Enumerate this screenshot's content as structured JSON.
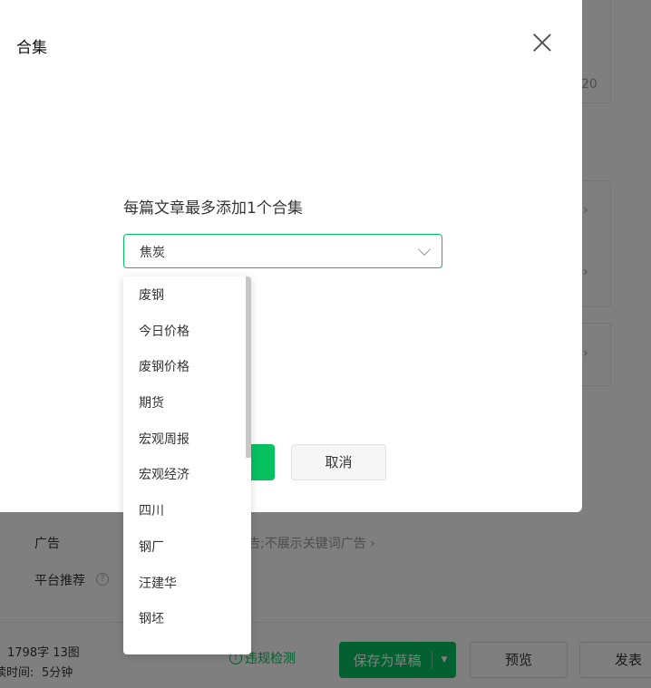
{
  "background": {
    "partial_count": "20",
    "ad_label": "广告",
    "ad_value": "告;不展示关键词广告",
    "ad_chevron": "›",
    "recommend_label": "平台推荐",
    "help_icon_glyph": "?",
    "card_chevron": "›"
  },
  "bottom_bar": {
    "word_count": "1798字 13图",
    "read_time_label": "读时间:",
    "read_time_value": "5分钟",
    "check_label": "违规检测",
    "save_draft_label": "保存为草稿",
    "save_draft_caret": "▼",
    "preview_label": "预览",
    "publish_label": "发表"
  },
  "dialog": {
    "title": "合集",
    "hint": "每篇文章最多添加1个合集",
    "selected_value": "焦炭",
    "cancel_label": "取消"
  },
  "dropdown": {
    "options": [
      "废钢",
      "今日价格",
      "废钢价格",
      "期货",
      "宏观周报",
      "宏观经济",
      "四川",
      "钢厂",
      "汪建华",
      "钢坯"
    ]
  },
  "colors": {
    "accent": "#07c160",
    "mask": "rgba(0,0,0,0.5)"
  }
}
